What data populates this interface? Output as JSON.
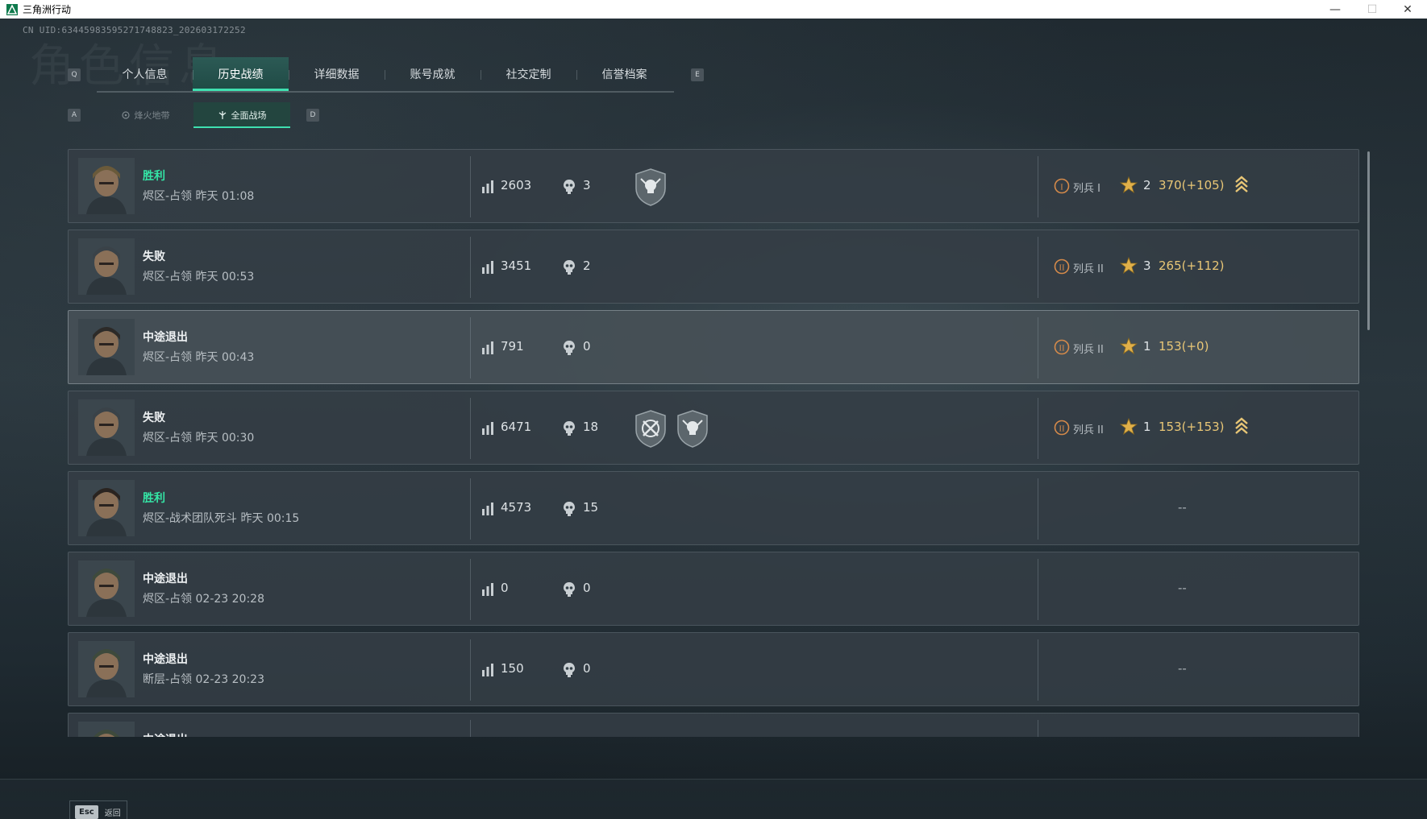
{
  "window": {
    "title": "三角洲行动"
  },
  "header": {
    "watermark": "角色信息",
    "uid": "CN UID:634459835952717488​23_202603172252"
  },
  "keys": {
    "prev_tab": "Q",
    "next_tab": "E",
    "prev_sub": "A",
    "next_sub": "D"
  },
  "tabs": [
    {
      "label": "个人信息"
    },
    {
      "label": "历史战绩"
    },
    {
      "label": "详细数据"
    },
    {
      "label": "账号成就"
    },
    {
      "label": "社交定制"
    },
    {
      "label": "信誉档案"
    }
  ],
  "active_tab": "历史战绩",
  "subtabs": [
    {
      "label": "烽火地带"
    },
    {
      "label": "全面战场"
    }
  ],
  "active_subtab": "全面战场",
  "matches": [
    {
      "result": "胜利",
      "win": true,
      "map": "烬区-占领 昨天 01:08",
      "score": "2603",
      "kills": "3",
      "badges": [
        "skull-shield-badge"
      ],
      "rank": "列兵 I",
      "rank_level": 1,
      "stars": "2",
      "points": "370(+105)",
      "promote": true
    },
    {
      "result": "失败",
      "win": false,
      "map": "烬区-占领 昨天 00:53",
      "score": "3451",
      "kills": "2",
      "badges": [],
      "rank": "列兵 II",
      "rank_level": 2,
      "stars": "3",
      "points": "265(+112)",
      "promote": false
    },
    {
      "result": "中途退出",
      "win": false,
      "map": "烬区-占领 昨天 00:43",
      "score": "791",
      "kills": "0",
      "badges": [],
      "rank": "列兵 II",
      "rank_level": 2,
      "stars": "1",
      "points": "153(+0)",
      "promote": false
    },
    {
      "result": "失败",
      "win": false,
      "map": "烬区-占领 昨天 00:30",
      "score": "6471",
      "kills": "18",
      "badges": [
        "cross-shield-badge",
        "skull-shield-badge"
      ],
      "rank": "列兵 II",
      "rank_level": 2,
      "stars": "1",
      "points": "153(+153)",
      "promote": true
    },
    {
      "result": "胜利",
      "win": true,
      "map": "烬区-战术团队死斗 昨天 00:15",
      "score": "4573",
      "kills": "15",
      "badges": [],
      "empty_rank": "--"
    },
    {
      "result": "中途退出",
      "win": false,
      "map": "烬区-占领 02-23 20:28",
      "score": "0",
      "kills": "0",
      "badges": [],
      "empty_rank": "--"
    },
    {
      "result": "中途退出",
      "win": false,
      "map": "断层-占领 02-23 20:23",
      "score": "150",
      "kills": "0",
      "badges": [],
      "empty_rank": "--"
    },
    {
      "result": "中途退出",
      "win": false,
      "map": "",
      "score": "",
      "kills": "",
      "badges": [],
      "empty_rank": ""
    }
  ],
  "footer": {
    "esc_key": "Esc",
    "esc_label": "返回"
  },
  "colors": {
    "accent": "#3fe0b0",
    "win": "#34e6a6",
    "gold": "#e8c676"
  }
}
